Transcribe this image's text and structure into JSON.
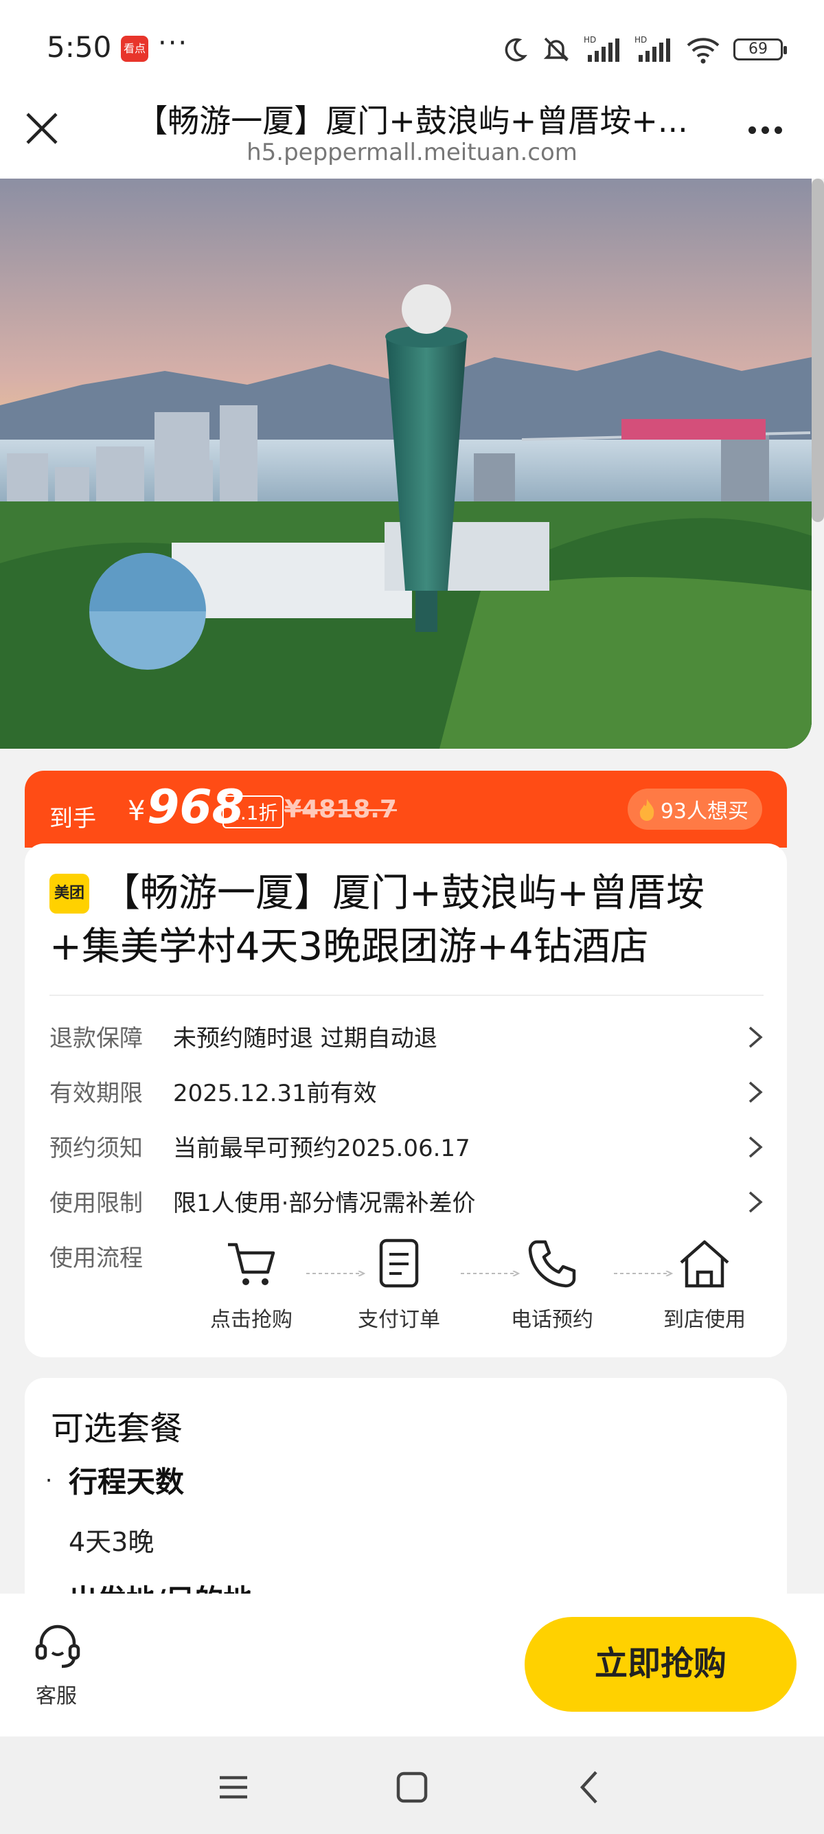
{
  "status_bar": {
    "time": "5:50",
    "app_badge": "看点",
    "more_dots": "···",
    "battery": "69",
    "icons": [
      "moon-icon",
      "mute-icon",
      "hd-signal-icon",
      "hd-signal-icon",
      "wifi-icon",
      "battery-icon"
    ]
  },
  "title_bar": {
    "title": "【畅游一厦】厦门+鼓浪屿+曾厝垵+...",
    "url": "h5.peppermall.meituan.com"
  },
  "price_band": {
    "label": "到手",
    "currency": "¥",
    "price": "968",
    "discount": "2.1折",
    "original_price": "¥4818.7",
    "want_count": "93人想买"
  },
  "product": {
    "brand": "美团",
    "title": "【畅游一厦】厦门+鼓浪屿+曾厝垵+集美学村4天3晚跟团游+4钻酒店",
    "info_rows": [
      {
        "label": "退款保障",
        "value": "未预约随时退 过期自动退"
      },
      {
        "label": "有效期限",
        "value": "2025.12.31前有效"
      },
      {
        "label": "预约须知",
        "value": "当前最早可预约2025.06.17"
      },
      {
        "label": "使用限制",
        "value": "限1人使用·部分情况需补差价"
      }
    ],
    "flow_label": "使用流程",
    "flow_steps": [
      {
        "label": "点击抢购",
        "icon": "cart-icon"
      },
      {
        "label": "支付订单",
        "icon": "document-icon"
      },
      {
        "label": "电话预约",
        "icon": "phone-icon"
      },
      {
        "label": "到店使用",
        "icon": "home-icon"
      }
    ]
  },
  "package": {
    "heading": "可选套餐",
    "group_title": "行程天数",
    "group_value": "4天3晚",
    "next_group_title": "出发地/目的地"
  },
  "action_bar": {
    "service_label": "客服",
    "buy_label": "立即抢购"
  },
  "colors": {
    "accent_orange": "#ff4c15",
    "brand_yellow": "#ffd100"
  }
}
